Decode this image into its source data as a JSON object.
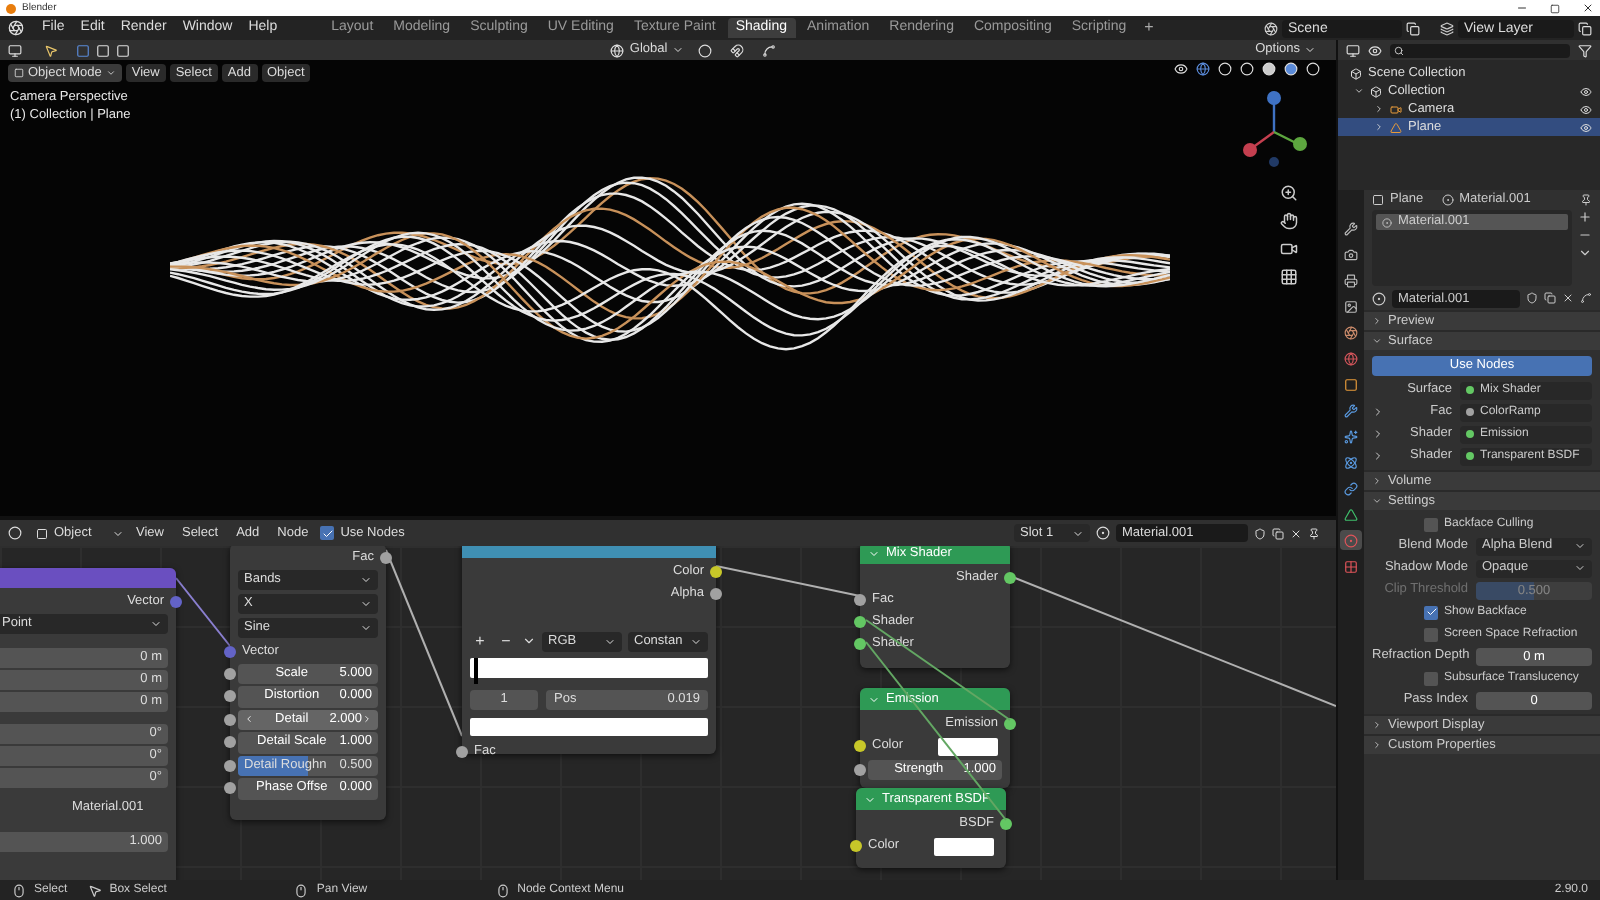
{
  "window": {
    "title": "Blender"
  },
  "menu": [
    "File",
    "Edit",
    "Render",
    "Window",
    "Help"
  ],
  "workspaces": [
    {
      "label": "Layout",
      "selected": false
    },
    {
      "label": "Modeling",
      "selected": false
    },
    {
      "label": "Sculpting",
      "selected": false
    },
    {
      "label": "UV Editing",
      "selected": false
    },
    {
      "label": "Texture Paint",
      "selected": false
    },
    {
      "label": "Shading",
      "selected": true
    },
    {
      "label": "Animation",
      "selected": false
    },
    {
      "label": "Rendering",
      "selected": false
    },
    {
      "label": "Compositing",
      "selected": false
    },
    {
      "label": "Scripting",
      "selected": false
    }
  ],
  "add_workspace": "+",
  "scene": "Scene",
  "view_layer": "View Layer",
  "tool_header": {
    "transform": "Global",
    "options": "Options"
  },
  "viewport": {
    "mode": "Object Mode",
    "menus": [
      "View",
      "Select",
      "Add",
      "Object"
    ],
    "info": [
      "Camera Perspective",
      "(1) Collection | Plane"
    ]
  },
  "outliner": {
    "root": "Scene Collection",
    "items": [
      {
        "label": "Collection",
        "kind": "collection",
        "expanded": true,
        "selected": false,
        "children": [
          {
            "label": "Camera",
            "kind": "camera",
            "expanded": false,
            "selected": false
          },
          {
            "label": "Plane",
            "kind": "mesh",
            "expanded": false,
            "selected": true
          }
        ]
      }
    ]
  },
  "properties": {
    "tabs": [
      {
        "kind": "tool",
        "selected": false
      },
      {
        "kind": "render",
        "selected": false
      },
      {
        "kind": "output",
        "selected": false
      },
      {
        "kind": "view_layer",
        "selected": false
      },
      {
        "kind": "scene",
        "selected": false
      },
      {
        "kind": "world",
        "selected": false
      },
      {
        "kind": "object",
        "selected": false
      },
      {
        "kind": "modifier",
        "selected": false
      },
      {
        "kind": "particles",
        "selected": false
      },
      {
        "kind": "physics",
        "selected": false
      },
      {
        "kind": "constraints",
        "selected": false
      },
      {
        "kind": "data",
        "selected": false
      },
      {
        "kind": "material",
        "selected": true
      },
      {
        "kind": "texture",
        "selected": false
      }
    ],
    "object": "Plane",
    "material": "Material.001",
    "slots": [
      {
        "label": "Material.001",
        "selected": true
      }
    ],
    "material_field": "Material.001",
    "panels": [
      {
        "title": "Preview",
        "expanded": false
      },
      {
        "title": "Surface",
        "expanded": true,
        "rows": [
          {
            "kind": "toggle_button",
            "label": "Use Nodes",
            "on": true
          },
          {
            "kind": "socket_link",
            "label": "Surface",
            "value": "Mix Shader",
            "color": "#63c763"
          },
          {
            "kind": "input_link",
            "label": "Fac",
            "value": "ColorRamp",
            "color": "#a1a1a1",
            "expanded": false
          },
          {
            "kind": "input_link",
            "label": "Shader",
            "value": "Emission",
            "color": "#63c763",
            "expanded": false
          },
          {
            "kind": "input_link",
            "label": "Shader",
            "value": "Transparent BSDF",
            "color": "#63c763",
            "expanded": false
          }
        ]
      },
      {
        "title": "Volume",
        "expanded": false
      },
      {
        "title": "Settings",
        "expanded": true,
        "rows": [
          {
            "kind": "checkbox",
            "label": "Backface Culling",
            "checked": false,
            "disabled": false
          },
          {
            "kind": "select",
            "label": "Blend Mode",
            "value": "Alpha Blend",
            "disabled": false
          },
          {
            "kind": "select",
            "label": "Shadow Mode",
            "value": "Opaque",
            "disabled": false
          },
          {
            "kind": "slider",
            "label": "Clip Threshold",
            "value": "0.500",
            "level": 0.5,
            "disabled": true
          },
          {
            "kind": "checkbox",
            "label": "Show Backface",
            "checked": true,
            "disabled": false
          },
          {
            "kind": "checkbox",
            "label": "Screen Space Refraction",
            "checked": false,
            "disabled": false
          },
          {
            "kind": "number",
            "label": "Refraction Depth",
            "value": "0 m",
            "disabled": false
          },
          {
            "kind": "checkbox",
            "label": "Subsurface Translucency",
            "checked": false,
            "disabled": false
          },
          {
            "kind": "number",
            "label": "Pass Index",
            "value": "0",
            "disabled": false
          }
        ]
      },
      {
        "title": "Viewport Display",
        "expanded": false
      },
      {
        "title": "Custom Properties",
        "expanded": false
      }
    ]
  },
  "node_editor": {
    "editor": "Object",
    "menus": [
      "View",
      "Select",
      "Add",
      "Node"
    ],
    "use_nodes": {
      "label": "Use Nodes",
      "checked": true
    },
    "slot": "Slot 1",
    "material": "Material.001",
    "nodes": [
      {
        "color": "#6a4fc0",
        "rows": [
          {
            "kind": "output",
            "label": "Vector",
            "color": "#6363c7"
          },
          {
            "kind": "dropdown",
            "value": "Point"
          },
          {
            "kind": "values",
            "values": [
              "0 m",
              "0 m",
              "0 m"
            ]
          },
          {
            "kind": "values",
            "values": [
              "0°",
              "0°",
              "0°"
            ]
          },
          {
            "kind": "text",
            "label": "Material.001"
          },
          {
            "kind": "values",
            "values": [
              "1.000"
            ]
          }
        ]
      },
      {
        "rows": [
          {
            "kind": "output",
            "label": "Fac",
            "color": "#a1a1a1"
          },
          {
            "kind": "dropdown",
            "value": "Bands"
          },
          {
            "kind": "dropdown",
            "value": "X"
          },
          {
            "kind": "dropdown",
            "value": "Sine"
          },
          {
            "kind": "input",
            "label": "Vector",
            "color": "#6363c7"
          },
          {
            "kind": "field",
            "label": "Scale",
            "value": "5.000",
            "color": "#a1a1a1",
            "hovered": false
          },
          {
            "kind": "field",
            "label": "Distortion",
            "value": "0.000",
            "color": "#a1a1a1",
            "hovered": false
          },
          {
            "kind": "field",
            "label": "Detail",
            "value": "2.000",
            "color": "#a1a1a1",
            "hovered": true
          },
          {
            "kind": "field",
            "label": "Detail Scale",
            "value": "1.000",
            "color": "#a1a1a1",
            "hovered": false
          },
          {
            "kind": "slider",
            "label": "Detail Roughn",
            "value": "0.500",
            "color": "#a1a1a1",
            "level": 0.5
          },
          {
            "kind": "field",
            "label": "Phase Offse",
            "value": "0.000",
            "color": "#a1a1a1",
            "hovered": false
          }
        ]
      },
      {
        "color": "#3f8fb3",
        "rows": [
          {
            "kind": "output",
            "label": "Color",
            "color": "#c7c729"
          },
          {
            "kind": "output",
            "label": "Alpha",
            "color": "#a1a1a1"
          },
          {
            "kind": "ramp_controls",
            "buttons": [
              "+",
              "−"
            ],
            "mode": "RGB",
            "interpolation": "Constan"
          },
          {
            "kind": "ramp",
            "level": 0.019
          },
          {
            "kind": "stop",
            "index": "1",
            "label": "Pos",
            "value": "0.019"
          },
          {
            "kind": "swatch"
          },
          {
            "kind": "input",
            "label": "Fac",
            "color": "#a1a1a1"
          }
        ]
      },
      {
        "title": "Mix Shader",
        "color": "#2e9a55",
        "rows": [
          {
            "kind": "output",
            "label": "Shader",
            "color": "#63c763"
          },
          {
            "kind": "input",
            "label": "Fac",
            "color": "#a1a1a1"
          },
          {
            "kind": "input",
            "label": "Shader",
            "color": "#63c763"
          },
          {
            "kind": "input",
            "label": "Shader",
            "color": "#63c763"
          }
        ]
      },
      {
        "title": "Emission",
        "color": "#2e9a55",
        "rows": [
          {
            "kind": "output",
            "label": "Emission",
            "color": "#63c763"
          },
          {
            "kind": "swatch_input",
            "label": "Color",
            "color": "#c7c729"
          },
          {
            "kind": "field",
            "label": "Strength",
            "value": "1.000",
            "color": "#a1a1a1",
            "hovered": false
          }
        ]
      },
      {
        "title": "Transparent BSDF",
        "color": "#2e9a55",
        "rows": [
          {
            "kind": "output",
            "label": "BSDF",
            "color": "#63c763"
          },
          {
            "kind": "swatch_input",
            "label": "Color",
            "color": "#c7c729"
          }
        ]
      }
    ]
  },
  "status_bar": {
    "items": [
      {
        "label": "Select",
        "kind": "mouse_left"
      },
      {
        "label": "Box Select",
        "kind": "mouse_drag"
      },
      {
        "label": "Pan View",
        "kind": "mouse_middle"
      },
      {
        "label": "Node Context Menu",
        "kind": "mouse_right"
      }
    ],
    "version": "2.90.0"
  }
}
